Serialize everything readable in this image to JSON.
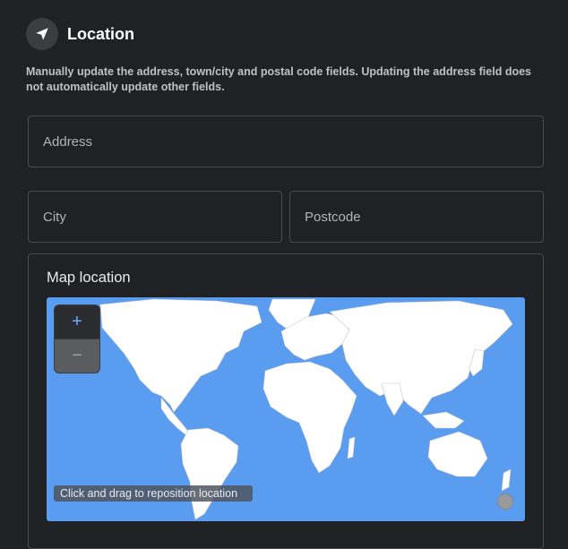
{
  "header": {
    "title": "Location",
    "icon": "navigation-arrow-icon"
  },
  "description": "Manually update the address, town/city and postal code fields. Updating the address field does not automatically update other fields.",
  "fields": {
    "address": {
      "placeholder": "Address",
      "value": ""
    },
    "city": {
      "placeholder": "City",
      "value": ""
    },
    "postcode": {
      "placeholder": "Postcode",
      "value": ""
    }
  },
  "map": {
    "label": "Map location",
    "zoom_in": "+",
    "zoom_out": "−",
    "hint": "Click and drag to reposition location",
    "colors": {
      "water": "#5a9cf0",
      "land": "#ffffff",
      "borders": "#c8c8c8"
    }
  }
}
